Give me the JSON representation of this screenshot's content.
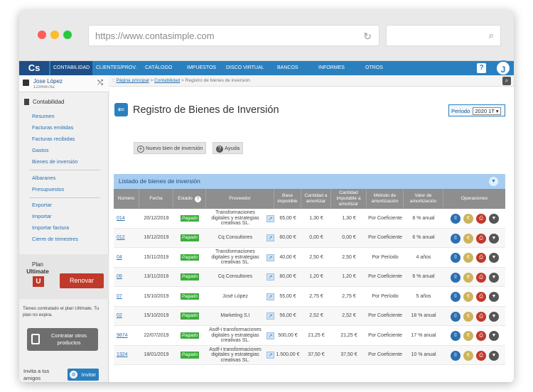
{
  "browser": {
    "url": "https://www.contasimple.com"
  },
  "nav": {
    "logo": "Cs",
    "items": [
      "CONTABILIDAD",
      "CLIENTES/PROV.",
      "CATÁLOGO",
      "IMPUESTOS",
      "DISCO VIRTUAL",
      "BANCOS",
      "INFORMES",
      "OTROS"
    ],
    "help": "?",
    "avatar": "J"
  },
  "user": {
    "name": "Jose López",
    "sub": "12345678Z"
  },
  "sidebar": {
    "section": "Contabilidad",
    "group1": [
      "Resumen",
      "Facturas emitidas",
      "Facturas recibidas",
      "Gastos",
      "Bienes de inversión"
    ],
    "group2": [
      "Albaranes",
      "Presupuestos"
    ],
    "group3": [
      "Exportar",
      "Importar",
      "Importar factura",
      "Cierre de trimestres"
    ],
    "plan_label": "Plan",
    "plan_name": "Ultimate",
    "plan_logo": "U",
    "renew": "Renovar",
    "plan_note": "Tienes contratado el plan Ultimate. Tu plan no expira.",
    "contract": "Contratar otros productos",
    "invite_text": "Invita a tus amigos",
    "invite_button": "Invitar"
  },
  "breadcrumb": {
    "prefix": "::",
    "home": "Página principal",
    "section": "Contabilidad",
    "current": "> Registro de bienes de inversión"
  },
  "page": {
    "title": "Registro de Bienes de Inversión",
    "period_label": "Período",
    "period_value": "2020 1T",
    "new_button": "Nuevo bien de inversión",
    "help_button": "Ayuda",
    "list_title": "Listado de bienes de inversión"
  },
  "table": {
    "headers": [
      "Número",
      "Fecha",
      "Estado",
      "Proveedor",
      "Base imponible",
      "Cantidad a amortizar",
      "Cantidad imputable a amortizar",
      "Método de amortización",
      "Valor de amortización",
      "Operaciones"
    ],
    "rows": [
      {
        "num": "014",
        "fecha": "20/12/2019",
        "estado": "Pagado",
        "proveedor": "Transformaciones digitales y estrategias creativas SL.",
        "base": "65,00 €",
        "cantidad": "1,30 €",
        "imputable": "1,30 €",
        "metodo": "Por Coeficiente",
        "valor": "8 % anual"
      },
      {
        "num": "012",
        "fecha": "16/12/2019",
        "estado": "Pagado",
        "proveedor": "Cq Consultores",
        "base": "60,00 €",
        "cantidad": "0,00 €",
        "imputable": "0,00 €",
        "metodo": "Por Coeficiente",
        "valor": "6 % anual"
      },
      {
        "num": "04",
        "fecha": "15/11/2019",
        "estado": "Pagado",
        "proveedor": "Transformaciones digitales y estrategias creativas SL.",
        "base": "40,00 €",
        "cantidad": "2,50 €",
        "imputable": "2,50 €",
        "metodo": "Por Período",
        "valor": "4 años"
      },
      {
        "num": "09",
        "fecha": "13/11/2019",
        "estado": "Pagado",
        "proveedor": "Cq Consultores",
        "base": "80,00 €",
        "cantidad": "1,20 €",
        "imputable": "1,20 €",
        "metodo": "Por Coeficiente",
        "valor": "6 % anual"
      },
      {
        "num": "07",
        "fecha": "15/10/2019",
        "estado": "Pagado",
        "proveedor": "José López",
        "base": "55,00 €",
        "cantidad": "2,75 €",
        "imputable": "2,75 €",
        "metodo": "Por Período",
        "valor": "5 años"
      },
      {
        "num": "02",
        "fecha": "15/10/2019",
        "estado": "Pagado",
        "proveedor": "Marketing S.I",
        "base": "56,00 €",
        "cantidad": "2,52 €",
        "imputable": "2,52 €",
        "metodo": "Por Coeficiente",
        "valor": "18 % anual"
      },
      {
        "num": "9874",
        "fecha": "22/07/2019",
        "estado": "Pagado",
        "proveedor": "Asdf-i transformaciones digitales y estrategias creativas SL.",
        "base": "500,00 €",
        "cantidad": "21,25 €",
        "imputable": "21,25 €",
        "metodo": "Por Coeficiente",
        "valor": "17 % anual"
      },
      {
        "num": "1324",
        "fecha": "18/01/2019",
        "estado": "Pagado",
        "proveedor": "Asdf-i transformaciones digitales y estrategias creativas SL.",
        "base": "1.500,00 €",
        "cantidad": "37,50 €",
        "imputable": "37,50 €",
        "metodo": "Por Coeficiente",
        "valor": "10 % anual"
      }
    ]
  },
  "colors": {
    "nav": "#2a7fbf",
    "nav_dark": "#1d4e86",
    "pagado": "#3cae3c",
    "renew": "#c0392b",
    "list_header": "#a6cdf0"
  }
}
